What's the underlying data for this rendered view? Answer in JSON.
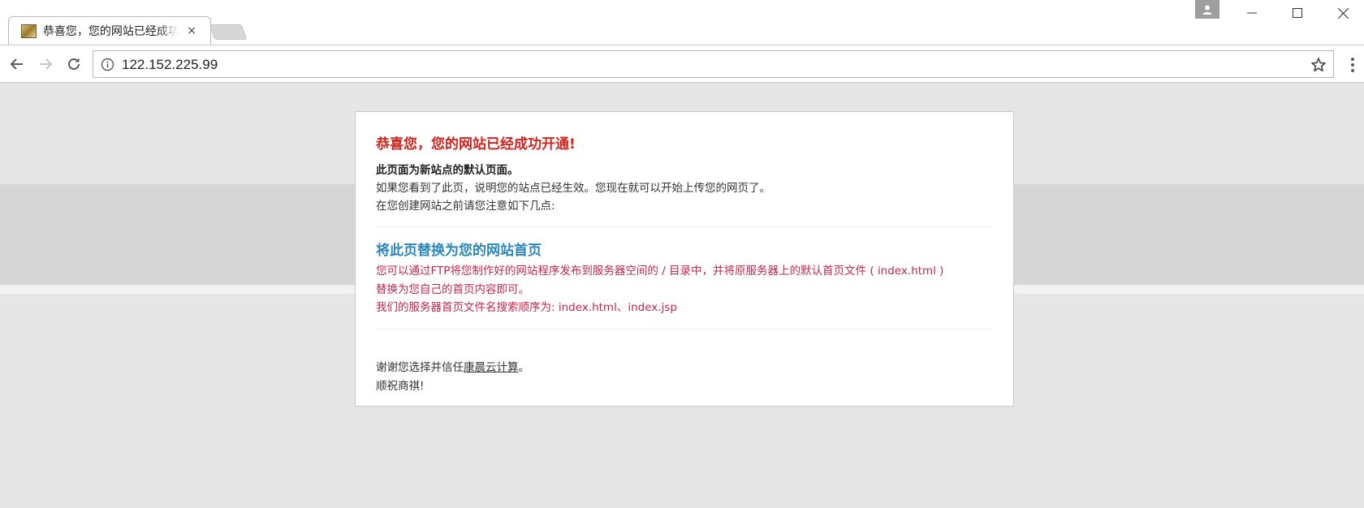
{
  "browser": {
    "tab_title": "恭喜您，您的网站已经成功开通！",
    "tab_close": "×",
    "url": "122.152.225.99",
    "icons": {
      "favicon": "site-favicon",
      "back": "back-arrow-icon",
      "forward": "forward-arrow-icon",
      "reload": "reload-icon",
      "info": "info-icon",
      "bookmark": "star-icon",
      "menu": "kebab-menu-icon",
      "profile": "profile-icon"
    }
  },
  "page": {
    "title": "恭喜您，您的网站已经成功开通!",
    "intro_bold": "此页面为新站点的默认页面。",
    "intro_line1": "如果您看到了此页，说明您的站点已经生效。您现在就可以开始上传您的网页了。",
    "intro_line2": "在您创建网站之前请您注意如下几点:",
    "section_title": "将此页替换为您的网站首页",
    "section_line1": "您可以通过FTP将您制作好的网站程序发布到服务器空间的 / 目录中，并将原服务器上的默认首页文件 ( index.html )",
    "section_line2": "替换为您自己的首页内容即可。",
    "section_line3": "我们的服务器首页文件名搜索顺序为: index.html、index.jsp",
    "thanks_prefix": "谢谢您选择并信任",
    "thanks_link": "康晨云计算",
    "thanks_suffix": "。",
    "closing": "顺祝商祺!"
  },
  "colors": {
    "title_red": "#d0241d",
    "section_blue": "#2a86b8",
    "body_red": "#c0274f",
    "page_bg": "#e6e6e6"
  }
}
